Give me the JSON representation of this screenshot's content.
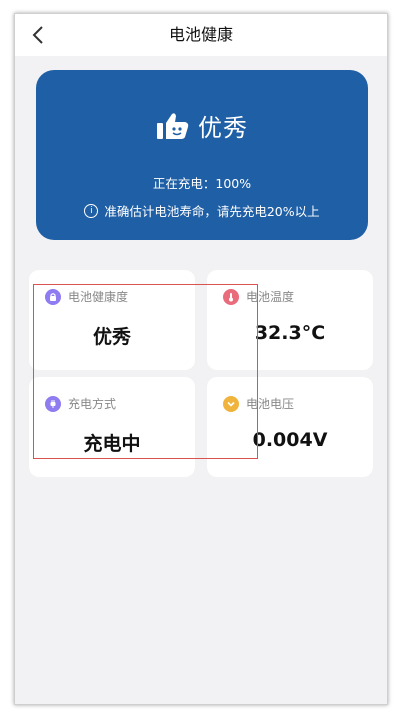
{
  "topbar": {
    "title": "电池健康"
  },
  "hero": {
    "rating": "优秀",
    "charging_status": "正在充电：100%",
    "tip": "准确估计电池寿命，请先充电20%以上"
  },
  "cards": [
    {
      "label": "电池健康度",
      "value": "优秀",
      "icon": "lock-icon",
      "color": "#8e7cf0"
    },
    {
      "label": "电池温度",
      "value": "32.3°C",
      "icon": "thermometer-icon",
      "color": "#ea6b7c"
    },
    {
      "label": "充电方式",
      "value": "充电中",
      "icon": "plug-icon",
      "color": "#8e7cf0"
    },
    {
      "label": "电池电压",
      "value": "0.004V",
      "icon": "chevron-down-icon",
      "color": "#f0b43d"
    }
  ],
  "colors": {
    "hero_bg": "#1f5fa6",
    "page_bg": "#f2f2f4",
    "annotation_box": "#d9534f"
  }
}
